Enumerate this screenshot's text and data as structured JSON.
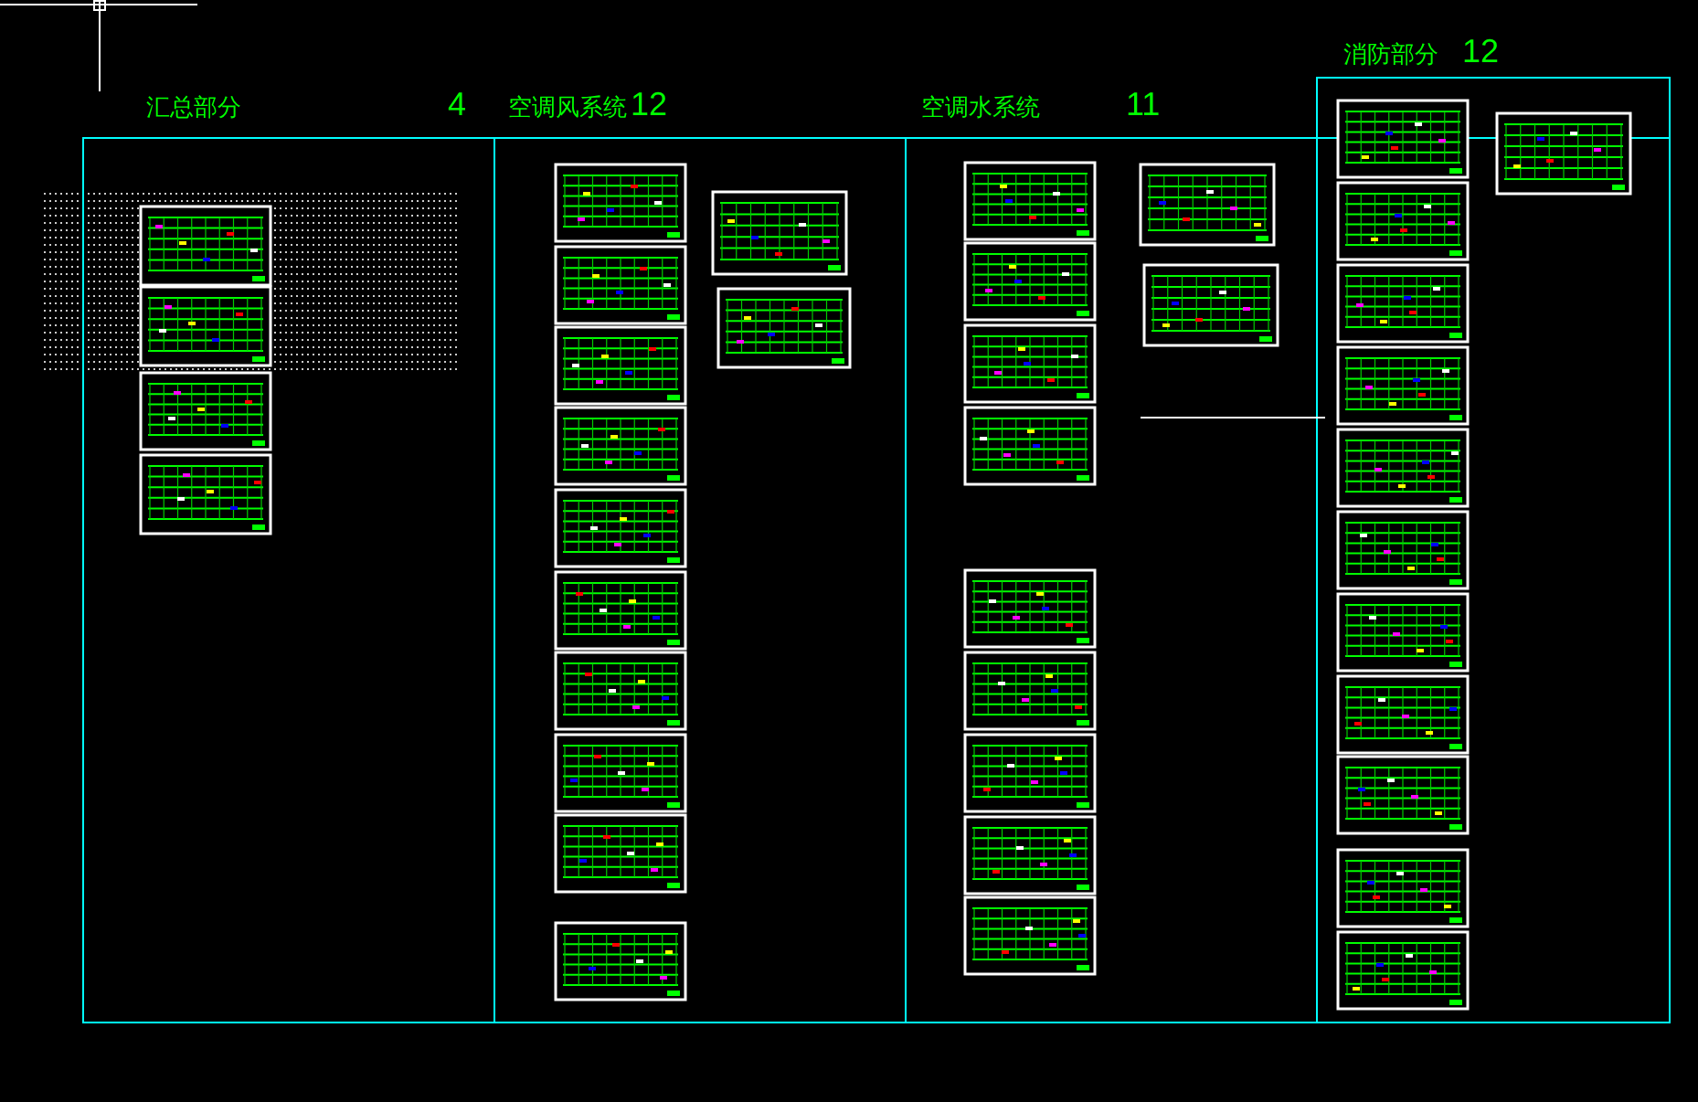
{
  "sections": [
    {
      "title": "汇总部分",
      "count": "4"
    },
    {
      "title": "空调风系统",
      "count": "12"
    },
    {
      "title": "空调水系统",
      "count": "11"
    },
    {
      "title": "消防部分",
      "count": "12"
    }
  ]
}
